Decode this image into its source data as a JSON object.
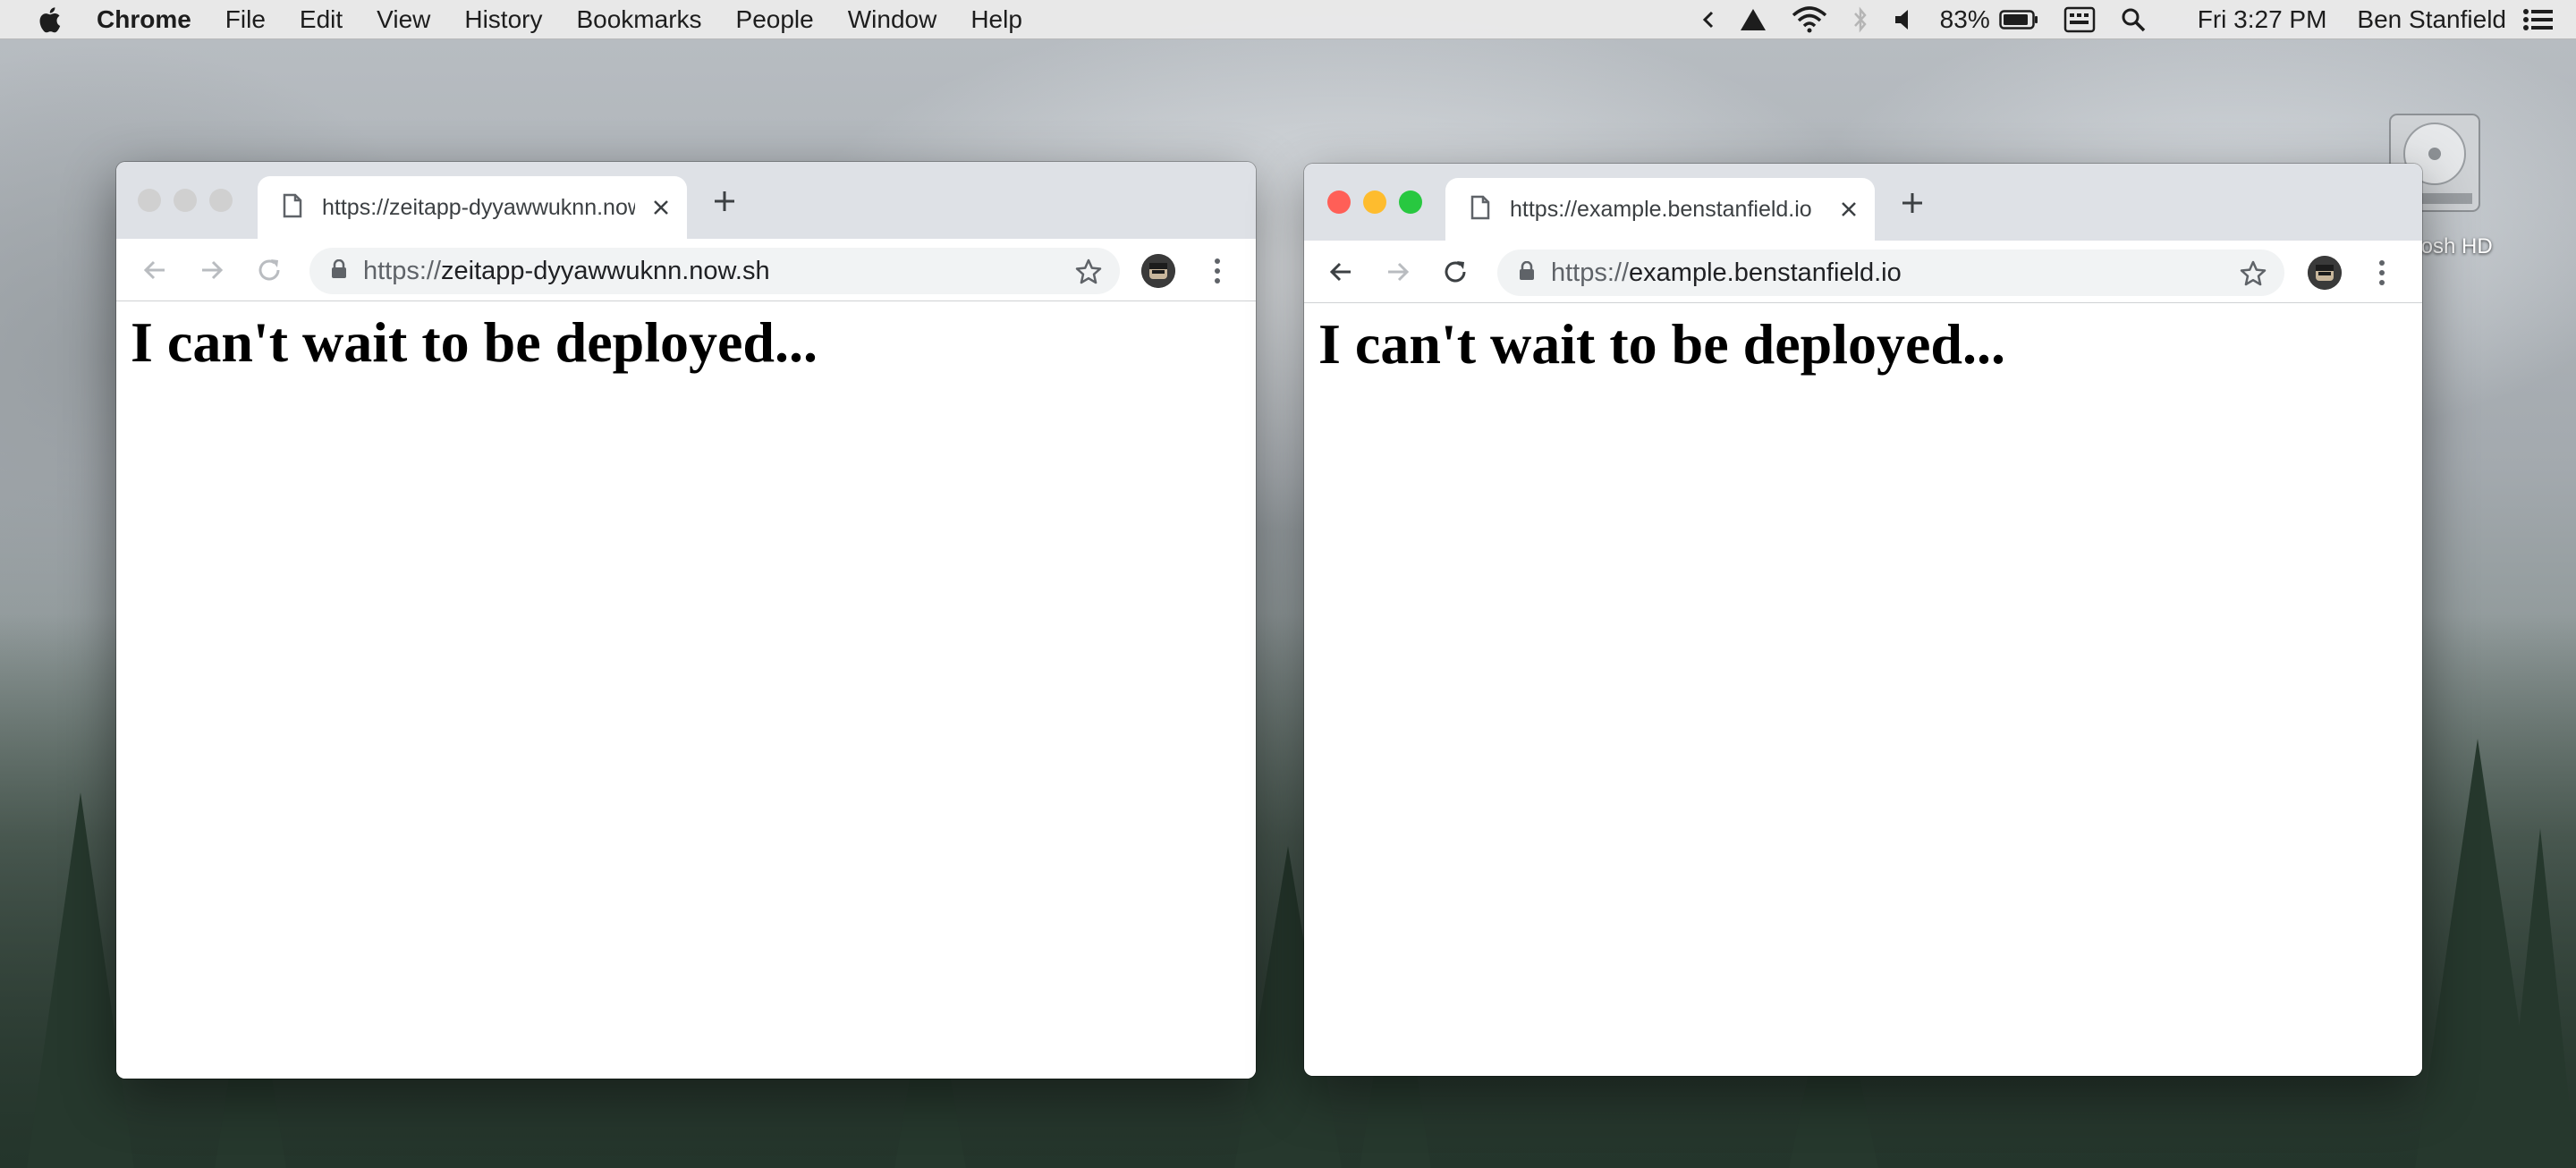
{
  "menubar": {
    "app_name": "Chrome",
    "items": [
      "File",
      "Edit",
      "View",
      "History",
      "Bookmarks",
      "People",
      "Window",
      "Help"
    ],
    "battery_percent": "83%",
    "clock": "Fri 3:27 PM",
    "user_name": "Ben Stanfield",
    "status_icons": [
      "chevron-left-icon",
      "drive-upload-icon",
      "wifi-icon",
      "bluetooth-icon",
      "volume-icon",
      "battery-icon",
      "keyboard-icon",
      "spotlight-search-icon",
      "notification-list-icon"
    ]
  },
  "desktop": {
    "drive_label": "tosh HD"
  },
  "windows": [
    {
      "focused": false,
      "tab_title": "https://zeitapp-dyyawwuknn.now.sh",
      "url_scheme": "https://",
      "url_rest": "zeitapp-dyyawwuknn.now.sh",
      "heading": "I can't wait to be deployed..."
    },
    {
      "focused": true,
      "tab_title": "https://example.benstanfield.io",
      "url_scheme": "https://",
      "url_rest": "example.benstanfield.io",
      "heading": "I can't wait to be deployed..."
    }
  ],
  "colors": {
    "traffic_close": "#ff5f57",
    "traffic_minimize": "#febc2e",
    "traffic_zoom": "#28c840",
    "traffic_inactive": "#d0d0d0"
  }
}
